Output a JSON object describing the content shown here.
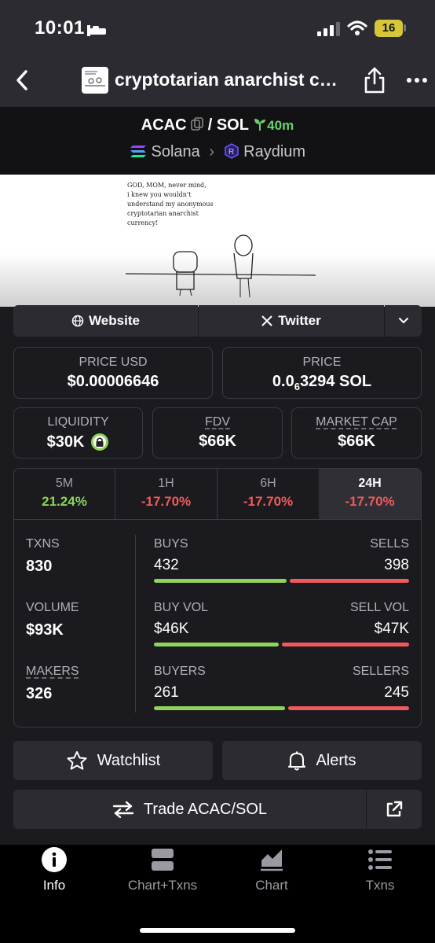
{
  "status": {
    "time": "10:01",
    "battery": "16"
  },
  "nav": {
    "title": "cryptotarian anarchist c…"
  },
  "pair": {
    "base": "ACAC",
    "sep": "/",
    "quote": "SOL",
    "age": "40m",
    "chain": "Solana",
    "dex": "Raydium"
  },
  "banner": {
    "caption_lines": [
      "GOD, MOM, never mind,",
      "i knew you wouldn't",
      "understand my anonymous",
      "cryptotarian anarchist",
      "currency!"
    ]
  },
  "links": {
    "website": "Website",
    "twitter": "Twitter"
  },
  "price": {
    "usd_label": "PRICE USD",
    "usd_value": "$0.00006646",
    "native_label": "PRICE",
    "native_prefix": "0.0",
    "native_sub": "6",
    "native_rest": "3294 SOL"
  },
  "metrics": {
    "liquidity_label": "LIQUIDITY",
    "liquidity_value": "$30K",
    "fdv_label": "FDV",
    "fdv_value": "$66K",
    "mcap_label": "MARKET CAP",
    "mcap_value": "$66K"
  },
  "tabs": [
    {
      "label": "5M",
      "change": "21.24%"
    },
    {
      "label": "1H",
      "change": "-17.70%"
    },
    {
      "label": "6H",
      "change": "-17.70%"
    },
    {
      "label": "24H",
      "change": "-17.70%"
    }
  ],
  "stats": {
    "txns_label": "TXNS",
    "txns_value": "830",
    "volume_label": "VOLUME",
    "volume_value": "$93K",
    "makers_label": "MAKERS",
    "makers_value": "326",
    "buys_label": "BUYS",
    "buys_value": "432",
    "sells_label": "SELLS",
    "sells_value": "398",
    "buyvol_label": "BUY VOL",
    "buyvol_value": "$46K",
    "sellvol_label": "SELL VOL",
    "sellvol_value": "$47K",
    "buyers_label": "BUYERS",
    "buyers_value": "261",
    "sellers_label": "SELLERS",
    "sellers_value": "245"
  },
  "actions": {
    "watchlist": "Watchlist",
    "alerts": "Alerts",
    "trade": "Trade ACAC/SOL"
  },
  "bottom_nav": [
    {
      "label": "Info",
      "icon": "info-icon"
    },
    {
      "label": "Chart+Txns",
      "icon": "layout-icon"
    },
    {
      "label": "Chart",
      "icon": "chart-icon"
    },
    {
      "label": "Txns",
      "icon": "list-icon"
    }
  ],
  "colors": {
    "up": "#8ed45a",
    "down": "#f05a5a",
    "bg": "#1a1a1f",
    "panel": "#2b2b31"
  }
}
